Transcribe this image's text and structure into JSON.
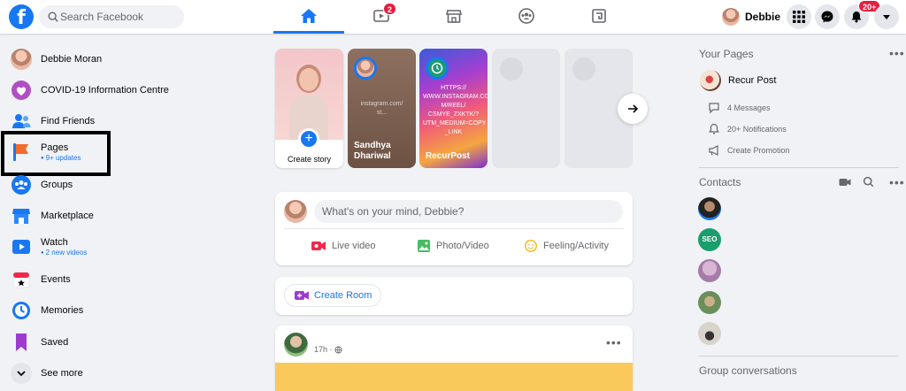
{
  "topbar": {
    "logo": "f",
    "search_placeholder": "Search Facebook",
    "watch_badge": "2",
    "user_name": "Debbie",
    "notifications_badge": "20+"
  },
  "sidebar": {
    "items": [
      {
        "label": "Debbie Moran",
        "icon": "avatar"
      },
      {
        "label": "COVID-19 Information Centre",
        "icon": "covid-heart-icon"
      },
      {
        "label": "Find Friends",
        "icon": "friends-icon"
      },
      {
        "label": "Pages",
        "sub": "9+ updates",
        "icon": "pages-flag-icon"
      },
      {
        "label": "Groups",
        "icon": "groups-icon"
      },
      {
        "label": "Marketplace",
        "icon": "marketplace-icon"
      },
      {
        "label": "Watch",
        "sub": "2 new videos",
        "icon": "watch-icon"
      },
      {
        "label": "Events",
        "icon": "events-icon"
      },
      {
        "label": "Memories",
        "icon": "memories-icon"
      },
      {
        "label": "Saved",
        "icon": "saved-icon"
      },
      {
        "label": "See more",
        "icon": "chevron-down-icon"
      }
    ]
  },
  "stories": {
    "create_label": "Create story",
    "items": [
      {
        "name": "Sandhya Dhariwal",
        "mid_text": "instagram.com/\nst..."
      },
      {
        "name": "RecurPost",
        "mid_text": "HTTPS://\nWWW.INSTAGRAM.CO\nM/REEL/\nCSMYE_ZXKTK/?\nUTM_MEDIUM=COPY\n_LINK"
      }
    ]
  },
  "composer": {
    "placeholder": "What's on your mind, Debbie?",
    "live_label": "Live video",
    "photo_label": "Photo/Video",
    "feeling_label": "Feeling/Activity"
  },
  "room": {
    "label": "Create Room"
  },
  "post": {
    "time": "17h ·"
  },
  "right": {
    "pages_title": "Your Pages",
    "page_name": "Recur Post",
    "messages": "4 Messages",
    "notifications": "20+ Notifications",
    "promotion": "Create Promotion",
    "contacts_title": "Contacts",
    "group_title": "Group conversations"
  },
  "colors": {
    "brand": "#1877f2",
    "badge": "#e41e3f",
    "highlight_box": "#000000"
  }
}
